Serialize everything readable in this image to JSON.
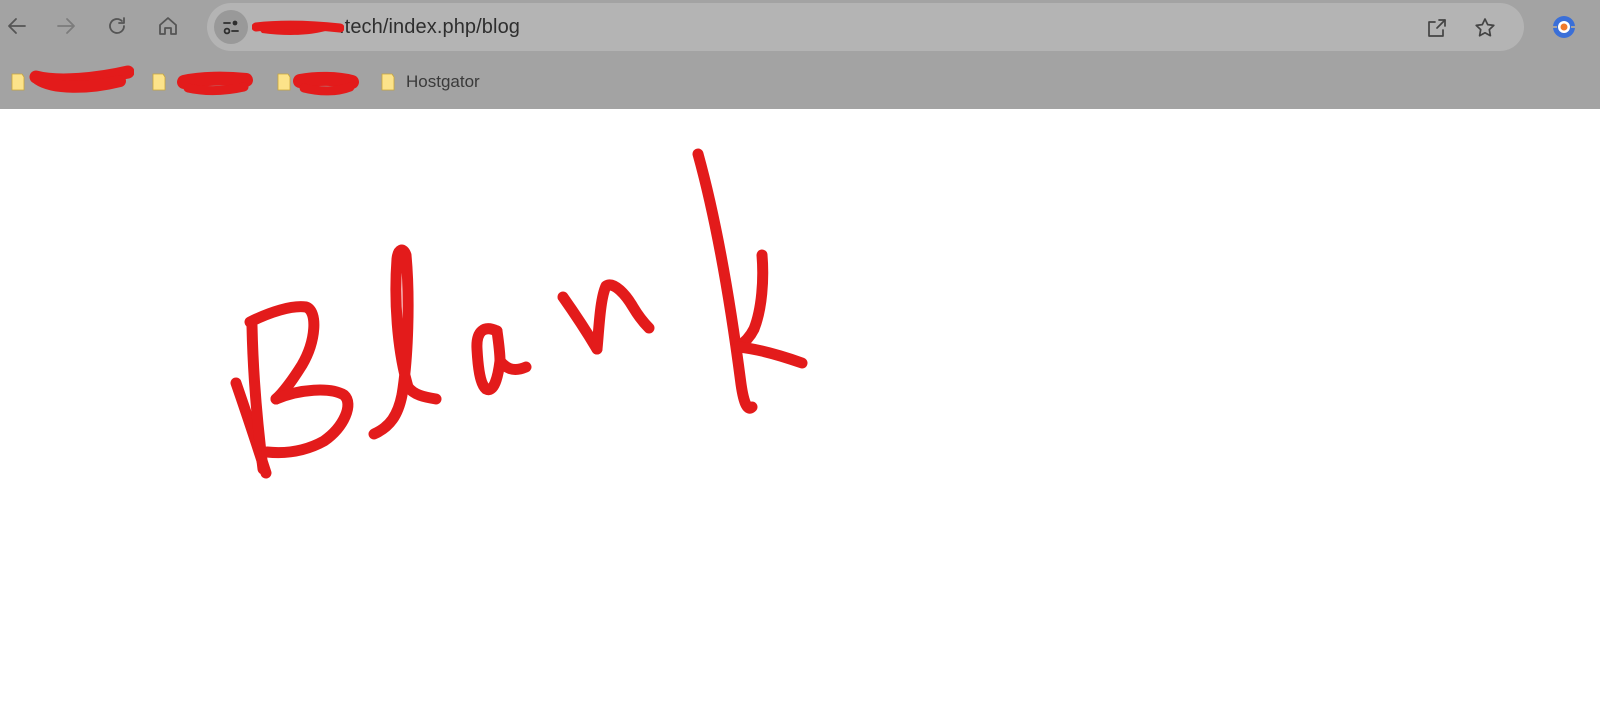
{
  "browser": {
    "toolbar": {
      "back": "back-icon",
      "forward": "forward-icon",
      "reload": "reload-icon",
      "home": "home-icon"
    },
    "address_bar": {
      "url_visible": ".tech/index.php/blog",
      "site_info_icon": "site-settings-icon",
      "share_icon": "share-icon",
      "bookmark_icon": "star-icon"
    },
    "extension_icon": "extension-icon",
    "bookmarks": [
      {
        "label": "",
        "redacted": true
      },
      {
        "label": "",
        "redacted": true
      },
      {
        "label": "",
        "redacted": true
      },
      {
        "label": "Hostgator",
        "redacted": false
      }
    ]
  },
  "page": {
    "handwritten_text": "Blank"
  },
  "colors": {
    "chrome_bg": "#a3a3a3",
    "address_bg": "#b4b4b4",
    "redaction_red": "#e31b1b",
    "ink_red": "#e31b1b",
    "folder_yellow": "#fce38a"
  }
}
